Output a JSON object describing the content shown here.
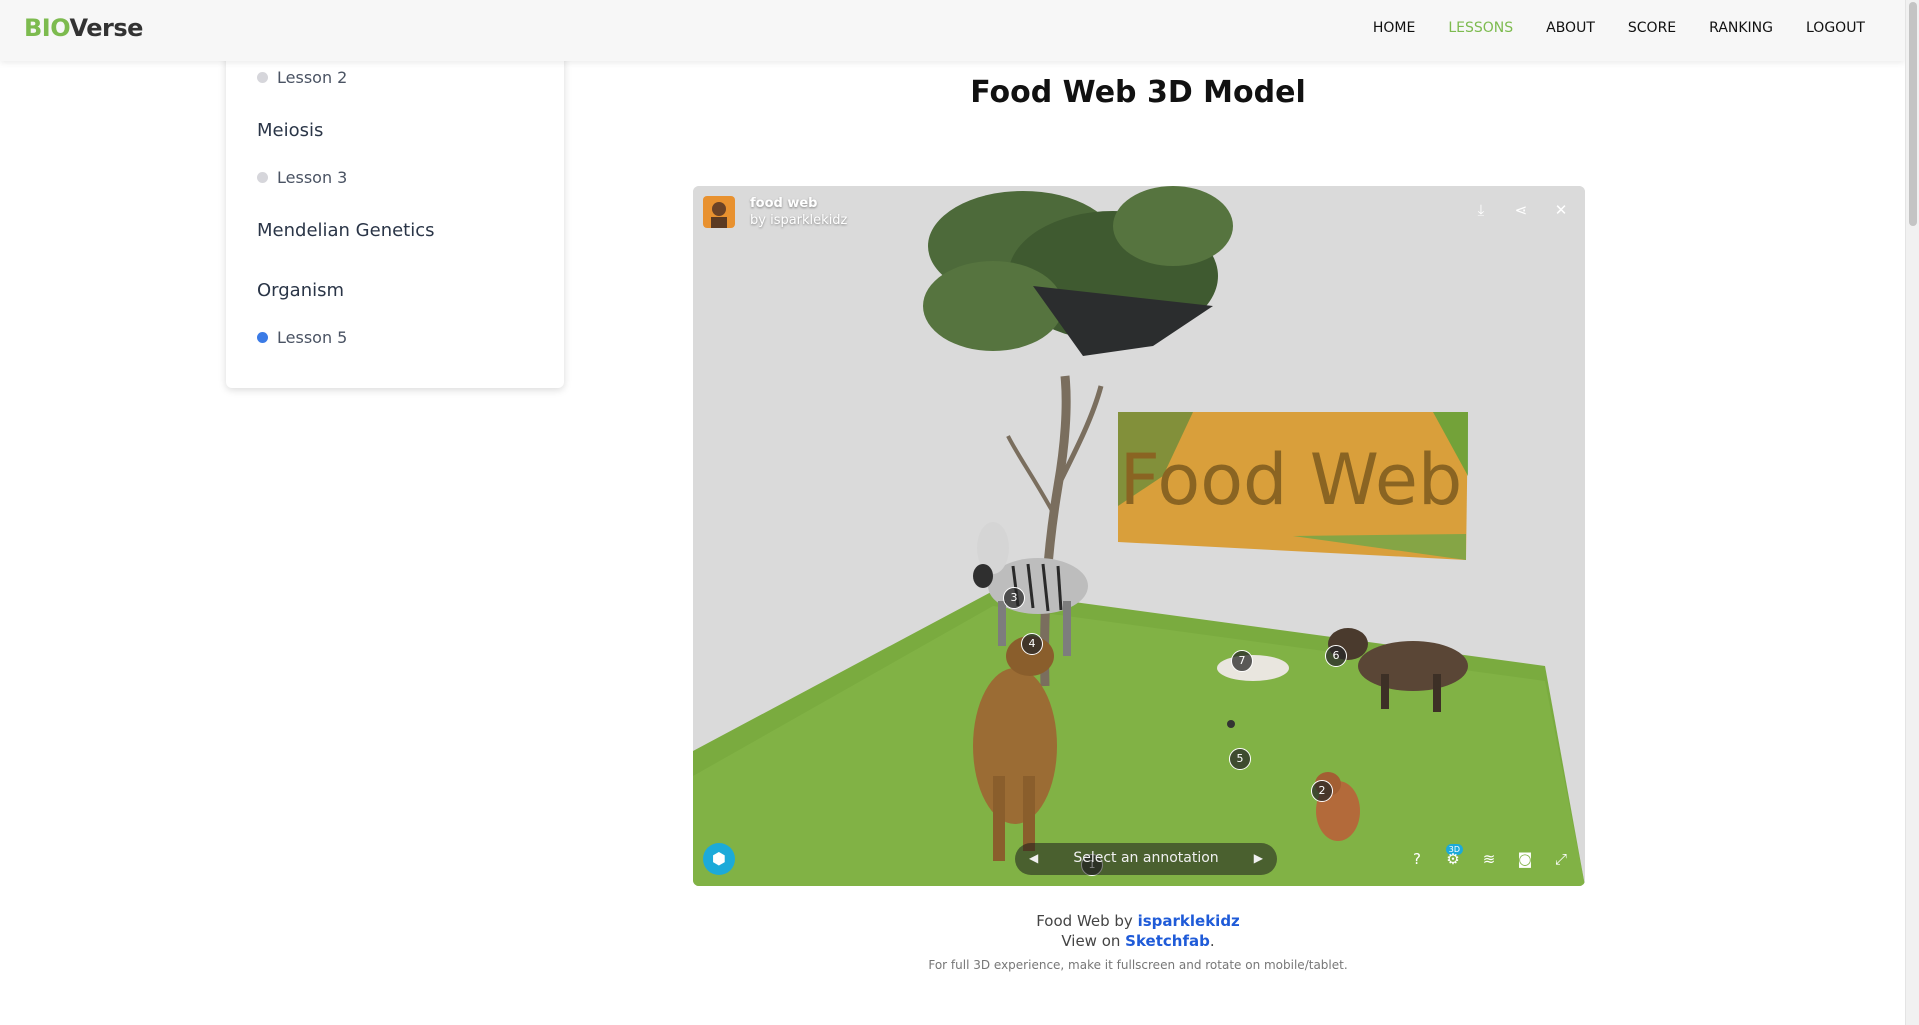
{
  "brand": {
    "part1": "BIO",
    "part2": "Verse"
  },
  "nav": {
    "home": "HOME",
    "lessons": "LESSONS",
    "about": "ABOUT",
    "score": "SCORE",
    "ranking": "RANKING",
    "logout": "LOGOUT"
  },
  "sidebar": {
    "lesson2": "Lesson 2",
    "topic_meiosis": "Meiosis",
    "lesson3": "Lesson 3",
    "topic_mendelian": "Mendelian Genetics",
    "topic_organism": "Organism",
    "lesson5": "Lesson 5"
  },
  "page": {
    "title": "Food Web 3D Model"
  },
  "viewer": {
    "model_title": "food web",
    "model_author": "by isparklekidz",
    "sign_text": "Food Web",
    "annotation_placeholder": "Select an annotation",
    "badge": "3D",
    "annotations": [
      "1",
      "2",
      "3",
      "4",
      "5",
      "6",
      "7"
    ]
  },
  "caption": {
    "line1_prefix": "Food Web by ",
    "line1_link": "isparklekidz",
    "line2_prefix": "View on ",
    "line2_link": "Sketchfab",
    "line2_suffix": ".",
    "note": "For full 3D experience, make it fullscreen and rotate on mobile/tablet."
  },
  "colors": {
    "accent_green": "#7dbb4f",
    "link_blue": "#1f5bd8",
    "active_dot": "#3b7be6",
    "sketchfab_blue": "#1caad9"
  }
}
